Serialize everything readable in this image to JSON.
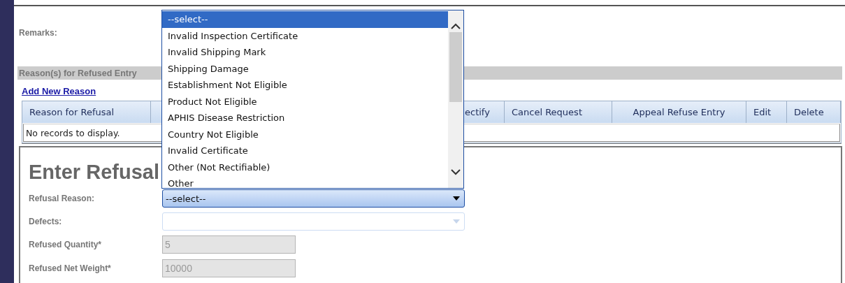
{
  "remarks": {
    "label": "Remarks:"
  },
  "section": {
    "title": "Reason(s) for Refused Entry"
  },
  "add_link": {
    "label": "Add New Reason"
  },
  "grid": {
    "columns": [
      {
        "label": "Reason for Refusal"
      },
      {
        "label": "ectify"
      },
      {
        "label": "Cancel Request"
      },
      {
        "label": "Appeal Refuse Entry"
      },
      {
        "label": "Edit"
      },
      {
        "label": "Delete"
      }
    ],
    "empty_message": "No records to display."
  },
  "form": {
    "title": "Enter Refusal",
    "fields": [
      {
        "kind": "select",
        "label": "Refusal Reason:",
        "value": "--select--",
        "open": true
      },
      {
        "kind": "select",
        "label": "Defects:",
        "open": false
      },
      {
        "kind": "text",
        "label": "Refused Quantity*",
        "value": "5",
        "disabled": true
      },
      {
        "kind": "text",
        "label": "Refused Net Weight*",
        "value": "10000",
        "disabled": true
      }
    ]
  },
  "dropdown": {
    "options": [
      {
        "label": "--select--",
        "selected": true
      },
      {
        "label": "Invalid Inspection Certificate",
        "selected": false
      },
      {
        "label": "Invalid Shipping Mark",
        "selected": false
      },
      {
        "label": "Shipping Damage",
        "selected": false
      },
      {
        "label": "Establishment Not Eligible",
        "selected": false
      },
      {
        "label": "Product Not Eligible",
        "selected": false
      },
      {
        "label": "APHIS Disease Restriction",
        "selected": false
      },
      {
        "label": "Country Not Eligible",
        "selected": false
      },
      {
        "label": "Invalid Certificate",
        "selected": false
      },
      {
        "label": "Other (Not Rectifiable)",
        "selected": false
      },
      {
        "label": "Other",
        "selected": false
      }
    ]
  }
}
